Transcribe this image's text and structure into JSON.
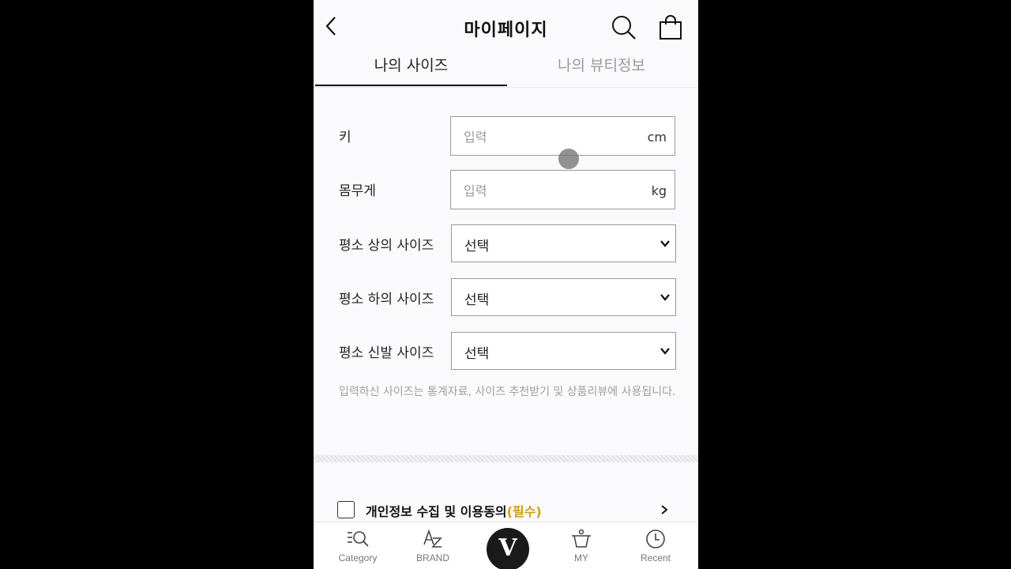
{
  "header": {
    "title": "마이페이지",
    "back_icon": "back-arrow-icon",
    "search_icon": "search-icon",
    "bag_icon": "shopping-bag-icon"
  },
  "tabs": [
    {
      "label": "나의 사이즈",
      "active": true
    },
    {
      "label": "나의 뷰티정보",
      "active": false
    }
  ],
  "form": {
    "height": {
      "label": "키",
      "placeholder": "입력",
      "value": "",
      "unit": "cm"
    },
    "weight": {
      "label": "몸무게",
      "placeholder": "입력",
      "value": "",
      "unit": "kg"
    },
    "top_size": {
      "label": "평소 상의 사이즈",
      "selected": "선택"
    },
    "bottom_size": {
      "label": "평소 하의 사이즈",
      "selected": "선택"
    },
    "shoe_size": {
      "label": "평소 신발 사이즈",
      "selected": "선택"
    }
  },
  "hint": "입력하신 사이즈는 통계자료, 사이즈 추천받기 및 상품리뷰에 사용됩니다.",
  "consent": {
    "label": "개인정보 수집 및 이용동의",
    "required": "(필수)",
    "checked": false
  },
  "bottom_nav": {
    "items": [
      {
        "label": "Category",
        "icon": "category-search-icon"
      },
      {
        "label": "BRAND",
        "icon": "brand-az-icon"
      },
      {
        "label": "V",
        "icon": "home-logo-icon"
      },
      {
        "label": "MY",
        "icon": "my-basket-icon"
      },
      {
        "label": "Recent",
        "icon": "clock-icon"
      }
    ]
  },
  "colors": {
    "accent_required": "#d1a01a",
    "background": "#fafafc",
    "nav_center": "#1a1a1a"
  }
}
